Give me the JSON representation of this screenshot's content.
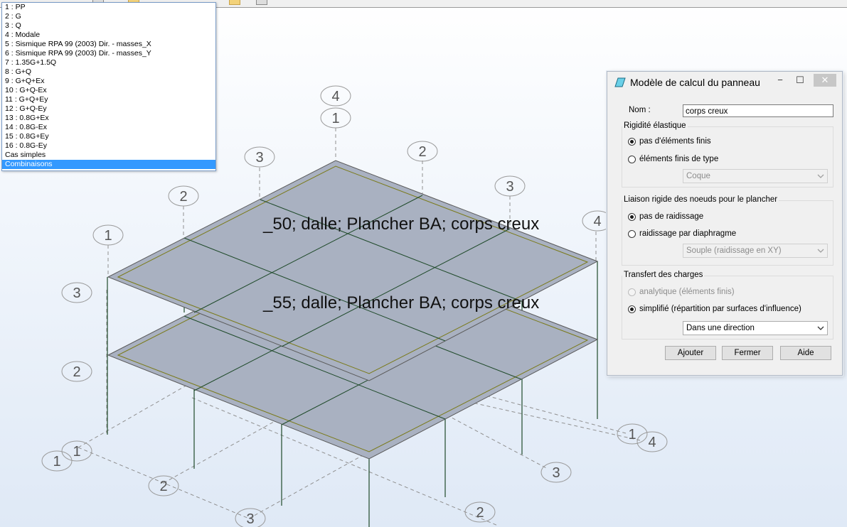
{
  "case_list": {
    "items": [
      "1 : PP",
      "2 : G",
      "3 : Q",
      "4 : Modale",
      "5 : Sismique RPA 99 (2003) Dir. - masses_X",
      "6 : Sismique RPA 99 (2003) Dir. - masses_Y",
      "7 : 1.35G+1.5Q",
      "8 : G+Q",
      "9 : G+Q+Ex",
      "10 : G+Q-Ex",
      "11 : G+Q+Ey",
      "12 : G+Q-Ey",
      "13 : 0.8G+Ex",
      "14 : 0.8G-Ex",
      "15 : 0.8G+Ey",
      "16 : 0.8G-Ey",
      "Cas simples",
      "Combinaisons"
    ],
    "selected_index": 17
  },
  "model": {
    "slab_upper_label": "_50; dalle; Plancher BA; corps creux",
    "slab_lower_label": "_55; dalle; Plancher BA; corps creux",
    "grid_bubbles": {
      "top_4": "4",
      "top_1": "1",
      "top_3": "3",
      "top_2": "2",
      "left_2": "2",
      "left_1": "1",
      "left_3": "3",
      "left_2b": "2",
      "right_3": "3",
      "right_4": "4",
      "bl_1a": "1",
      "bl_1b": "1",
      "bl_2": "2",
      "bl_3": "3",
      "br_3": "3",
      "br_2": "2",
      "br_1": "1",
      "br_4": "4"
    }
  },
  "dialog": {
    "title": "Modèle de calcul du panneau",
    "minimize": "−",
    "maximize": "☐",
    "close": "✕",
    "name_label": "Nom :",
    "name_value": "corps creux",
    "rigidity": {
      "title": "Rigidité élastique",
      "opt1": "pas d'éléments finis",
      "opt2": "éléments finis de type",
      "type_value": "Coque"
    },
    "liaison": {
      "title": "Liaison rigide des noeuds pour le plancher",
      "opt1": "pas de raidissage",
      "opt2": "raidissage par diaphragme",
      "type_value": "Souple (raidissage en XY)"
    },
    "transfert": {
      "title": "Transfert des charges",
      "opt1": "analytique (éléments finis)",
      "opt2": "simplifié (répartition par surfaces d'influence)",
      "direction_value": "Dans une direction"
    },
    "buttons": {
      "add": "Ajouter",
      "close": "Fermer",
      "help": "Aide"
    }
  },
  "colors": {
    "slab_fill": "#a9b1c1",
    "slab_edge": "#5a5a5a",
    "slab_inner": "#7a7a1a",
    "beam": "#1f4a2a",
    "grid_dash": "#909090",
    "selection": "#3399ff"
  }
}
